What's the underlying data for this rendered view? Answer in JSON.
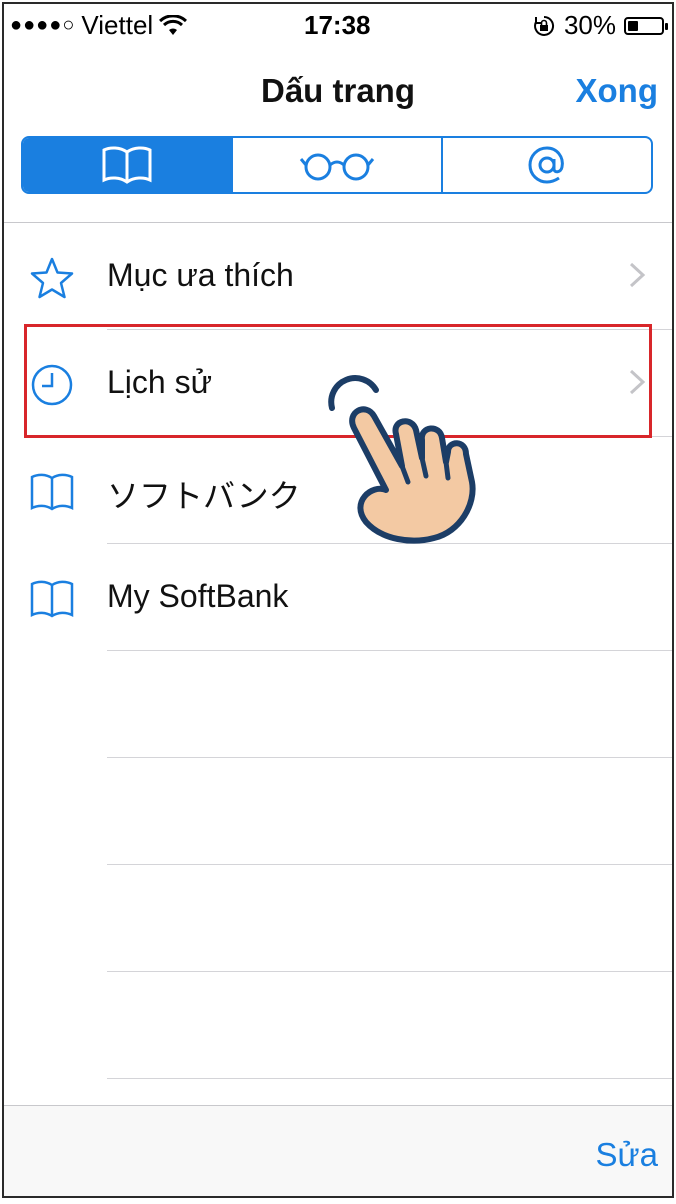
{
  "status_bar": {
    "signal_dots": "●●●●○",
    "carrier": "Viettel",
    "time": "17:38",
    "battery_percent": "30%",
    "battery_level": 0.3
  },
  "nav": {
    "title": "Dấu trang",
    "done_label": "Xong"
  },
  "segments": [
    {
      "icon": "book-icon",
      "active": true
    },
    {
      "icon": "glasses-icon",
      "active": false
    },
    {
      "icon": "at-icon",
      "active": false
    }
  ],
  "list": {
    "items": [
      {
        "icon": "star-icon",
        "label": "Mục ưa thích",
        "has_chevron": true
      },
      {
        "icon": "clock-icon",
        "label": "Lịch sử",
        "has_chevron": true
      },
      {
        "icon": "book-icon",
        "label": "ソフトバンク",
        "has_chevron": false
      },
      {
        "icon": "book-icon",
        "label": "My SoftBank",
        "has_chevron": false
      }
    ]
  },
  "toolbar": {
    "edit_label": "Sửa"
  },
  "colors": {
    "accent": "#1a7fe0",
    "highlight": "#d8262a"
  }
}
